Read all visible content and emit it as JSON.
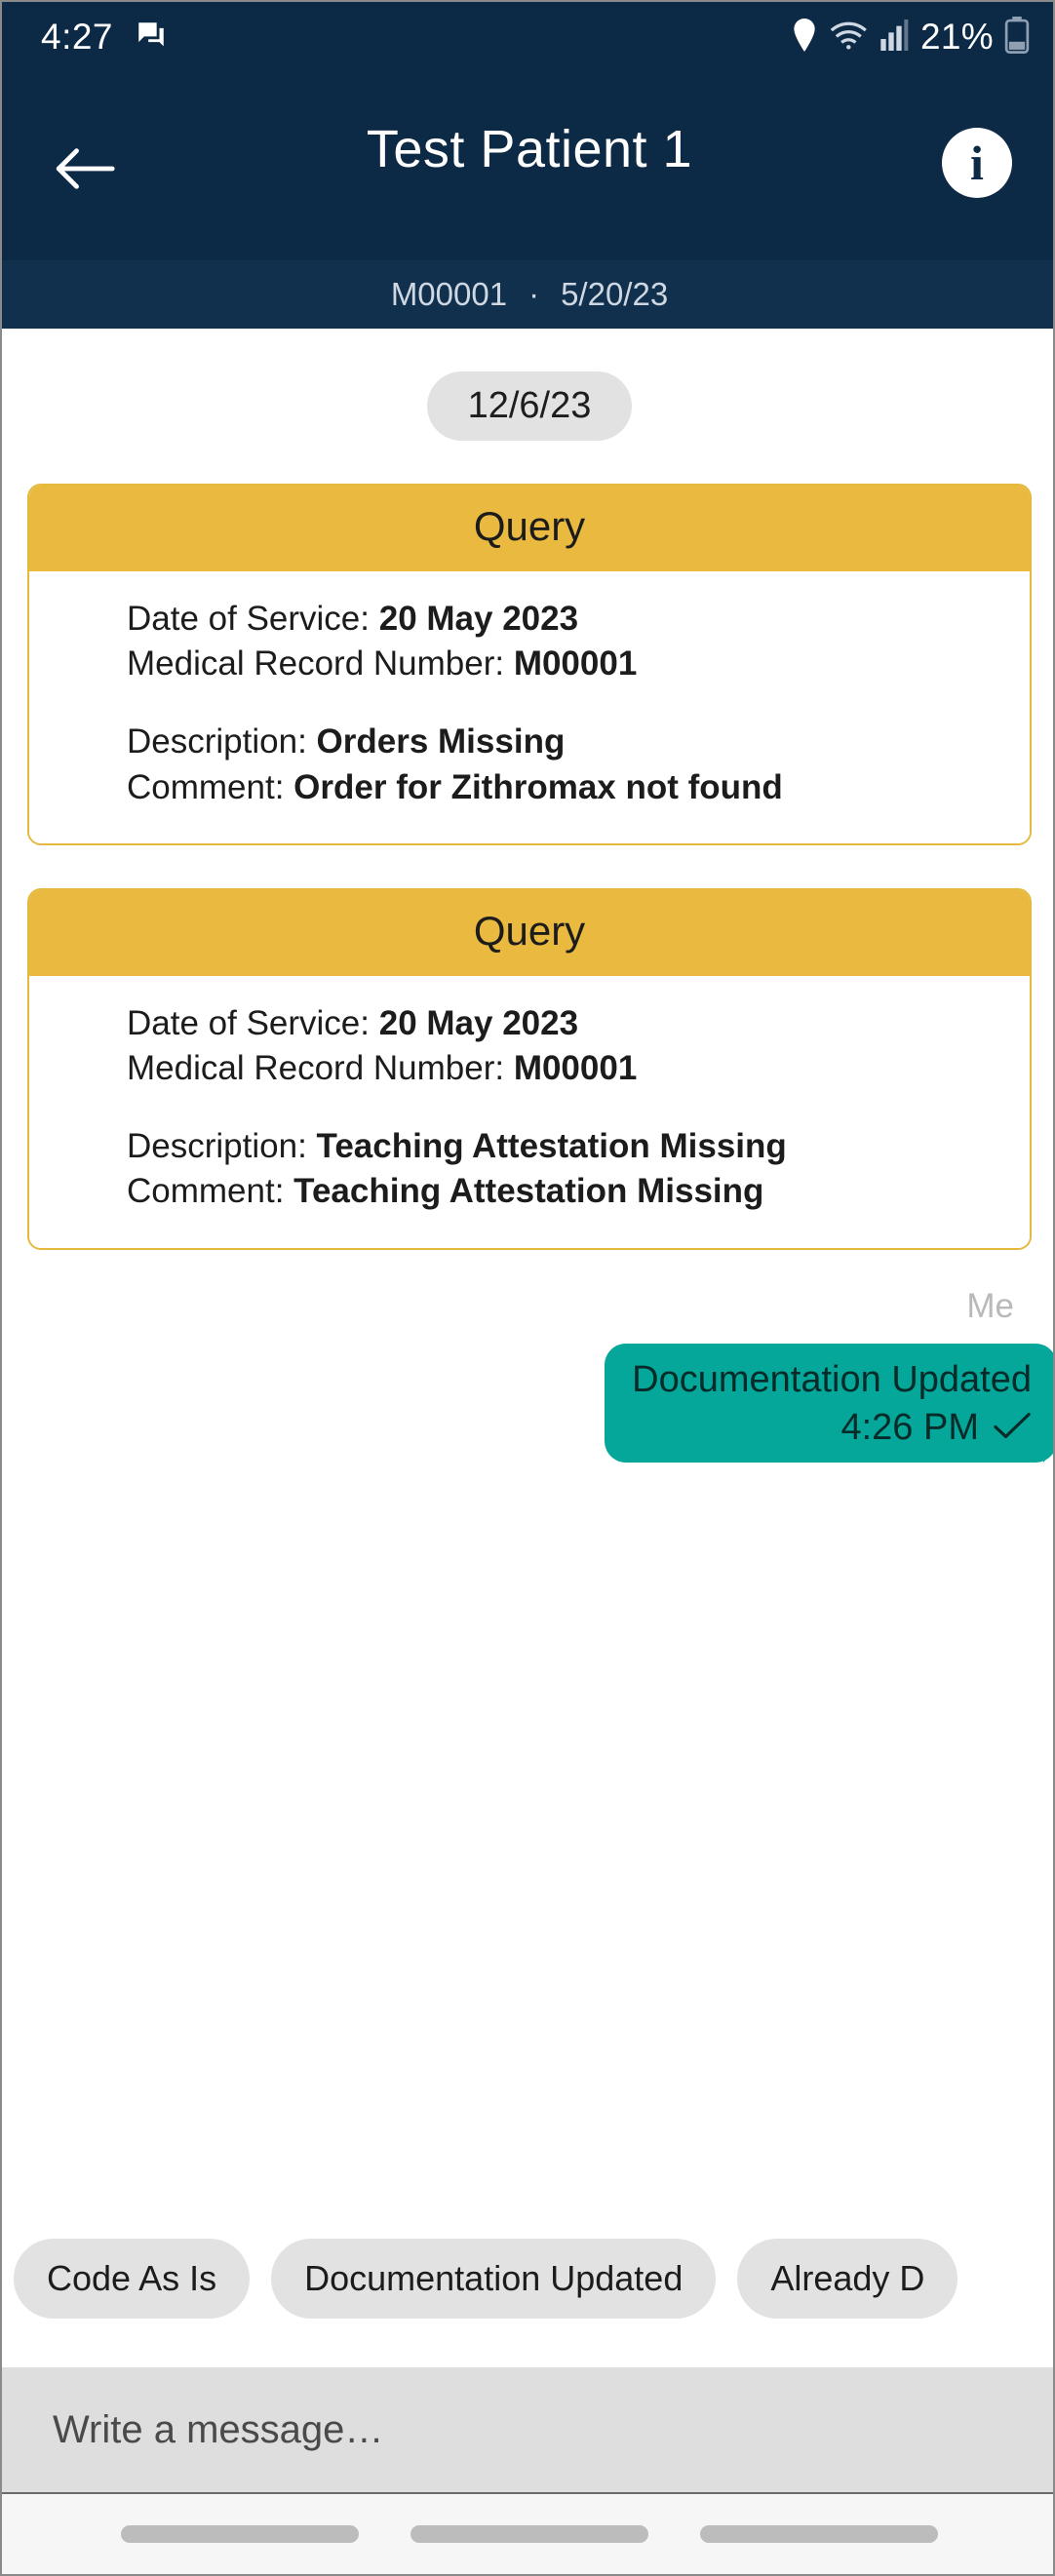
{
  "status_bar": {
    "time": "4:27",
    "battery_percent": "21%",
    "icons": [
      "chat-notification-icon",
      "location-pin-icon",
      "wifi-icon",
      "cellular-signal-icon",
      "battery-icon"
    ]
  },
  "app_bar": {
    "back_label": "←",
    "title": "Test Patient 1",
    "info_glyph": "i"
  },
  "sub_bar": {
    "mrn": "M00001",
    "separator": "·",
    "date": "5/20/23"
  },
  "chat": {
    "date_divider": "12/6/23",
    "cards": [
      {
        "header": "Query",
        "date_of_service_label": "Date of Service: ",
        "date_of_service_value": "20 May 2023",
        "mrn_label": "Medical Record Number: ",
        "mrn_value": "M00001",
        "description_label": "Description: ",
        "description_value": "Orders Missing",
        "comment_label": "Comment: ",
        "comment_value": "Order for Zithromax not found"
      },
      {
        "header": "Query",
        "date_of_service_label": "Date of Service: ",
        "date_of_service_value": "20 May 2023",
        "mrn_label": "Medical Record Number: ",
        "mrn_value": "M00001",
        "description_label": "Description: ",
        "description_value": "Teaching Attestation Missing",
        "comment_label": "Comment: ",
        "comment_value": "Teaching Attestation Missing"
      }
    ],
    "sent_message": {
      "sender_label": "Me",
      "text": "Documentation Updated",
      "time": "4:26 PM",
      "status_icon": "✓"
    }
  },
  "quick_replies": [
    {
      "label": "Code As Is"
    },
    {
      "label": "Documentation Updated"
    },
    {
      "label": "Already D"
    }
  ],
  "composer": {
    "placeholder": "Write a message…",
    "value": ""
  },
  "colors": {
    "header_navy": "#0c2945",
    "subbar_navy": "#10304d",
    "query_yellow": "#e9ba3f",
    "bubble_teal": "#05a79a",
    "chip_gray": "#e2e2e2"
  }
}
